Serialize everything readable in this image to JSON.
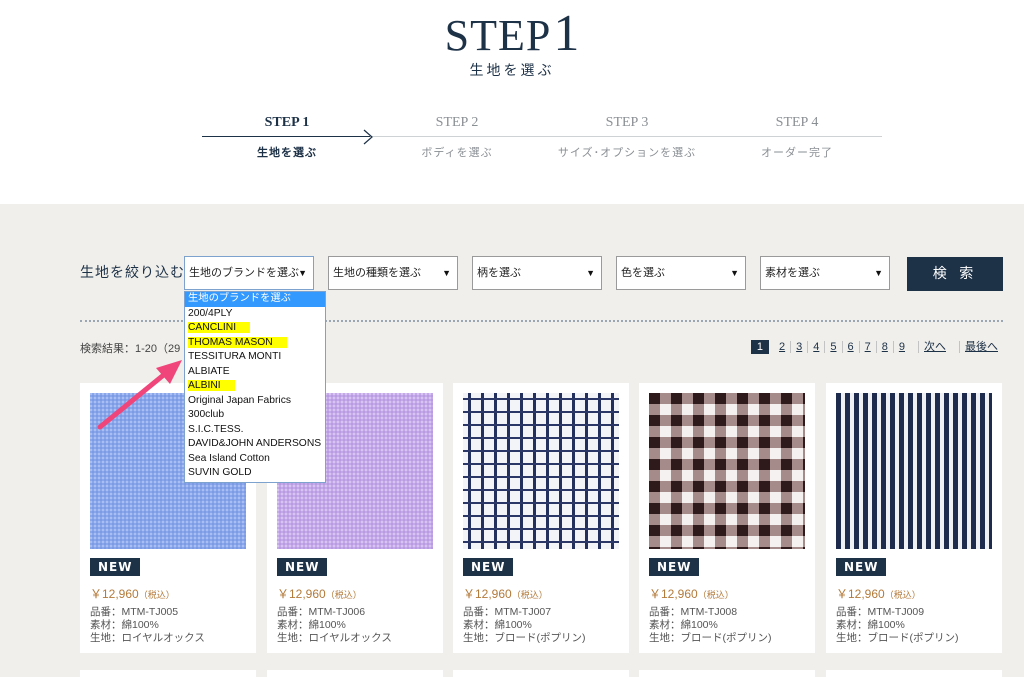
{
  "header": {
    "step_word": "STEP",
    "step_number": "1",
    "subtitle": "生地を選ぶ"
  },
  "steps": [
    {
      "label": "STEP 1",
      "desc": "生地を選ぶ",
      "active": true
    },
    {
      "label": "STEP 2",
      "desc": "ボディを選ぶ",
      "active": false
    },
    {
      "label": "STEP 3",
      "desc": "サイズ･オプションを選ぶ",
      "active": false
    },
    {
      "label": "STEP 4",
      "desc": "オーダー完了",
      "active": false
    }
  ],
  "filter": {
    "label": "生地を絞り込む",
    "selects": [
      "生地のブランドを選ぶ",
      "生地の種類を選ぶ",
      "柄を選ぶ",
      "色を選ぶ",
      "素材を選ぶ"
    ],
    "search_button": "検 索"
  },
  "results": {
    "count": "検索結果：1-20（29"
  },
  "pager": {
    "pages": [
      "1",
      "2",
      "3",
      "4",
      "5",
      "6",
      "7",
      "8",
      "9"
    ],
    "next": "次へ",
    "last": "最後へ"
  },
  "dropdown": {
    "options": [
      {
        "label": "生地のブランドを選ぶ",
        "state": "selected"
      },
      {
        "label": "200/4PLY",
        "state": ""
      },
      {
        "label": "CANCLINI",
        "state": "highlight"
      },
      {
        "label": "THOMAS MASON",
        "state": "highlight"
      },
      {
        "label": "TESSITURA MONTI",
        "state": ""
      },
      {
        "label": "ALBIATE",
        "state": ""
      },
      {
        "label": "ALBINI",
        "state": "highlight"
      },
      {
        "label": "Original Japan Fabrics",
        "state": ""
      },
      {
        "label": "300club",
        "state": ""
      },
      {
        "label": "S.I.C.TESS.",
        "state": ""
      },
      {
        "label": "DAVID&JOHN ANDERSONS",
        "state": ""
      },
      {
        "label": "Sea Island Cotton",
        "state": ""
      },
      {
        "label": "SUVIN GOLD",
        "state": ""
      }
    ]
  },
  "products": [
    {
      "badge": "NEW",
      "price": "￥12,960",
      "tax": "（税込）",
      "code": "品番：MTM-TJ005",
      "material": "素材：綿100%",
      "fabric": "生地：ロイヤルオックス",
      "pattern": "oxford-blue"
    },
    {
      "badge": "NEW",
      "price": "￥12,960",
      "tax": "（税込）",
      "code": "品番：MTM-TJ006",
      "material": "素材：綿100%",
      "fabric": "生地：ロイヤルオックス",
      "pattern": "oxford-lavender"
    },
    {
      "badge": "NEW",
      "price": "￥12,960",
      "tax": "（税込）",
      "code": "品番：MTM-TJ007",
      "material": "素材：綿100%",
      "fabric": "生地：ブロード(ポプリン)",
      "pattern": "windowpane-navy"
    },
    {
      "badge": "NEW",
      "price": "￥12,960",
      "tax": "（税込）",
      "code": "品番：MTM-TJ008",
      "material": "素材：綿100%",
      "fabric": "生地：ブロード(ポプリン)",
      "pattern": "gingham-brown"
    },
    {
      "badge": "NEW",
      "price": "￥12,960",
      "tax": "（税込）",
      "code": "品番：MTM-TJ009",
      "material": "素材：綿100%",
      "fabric": "生地：ブロード(ポプリン)",
      "pattern": "stripe-navy"
    }
  ],
  "colors": {
    "navy": "#1d3147",
    "background": "#f0efeb",
    "price": "#b37a3a",
    "highlight": "#ffff00",
    "selected": "#3399ff",
    "annotation_arrow": "#f0457a"
  }
}
